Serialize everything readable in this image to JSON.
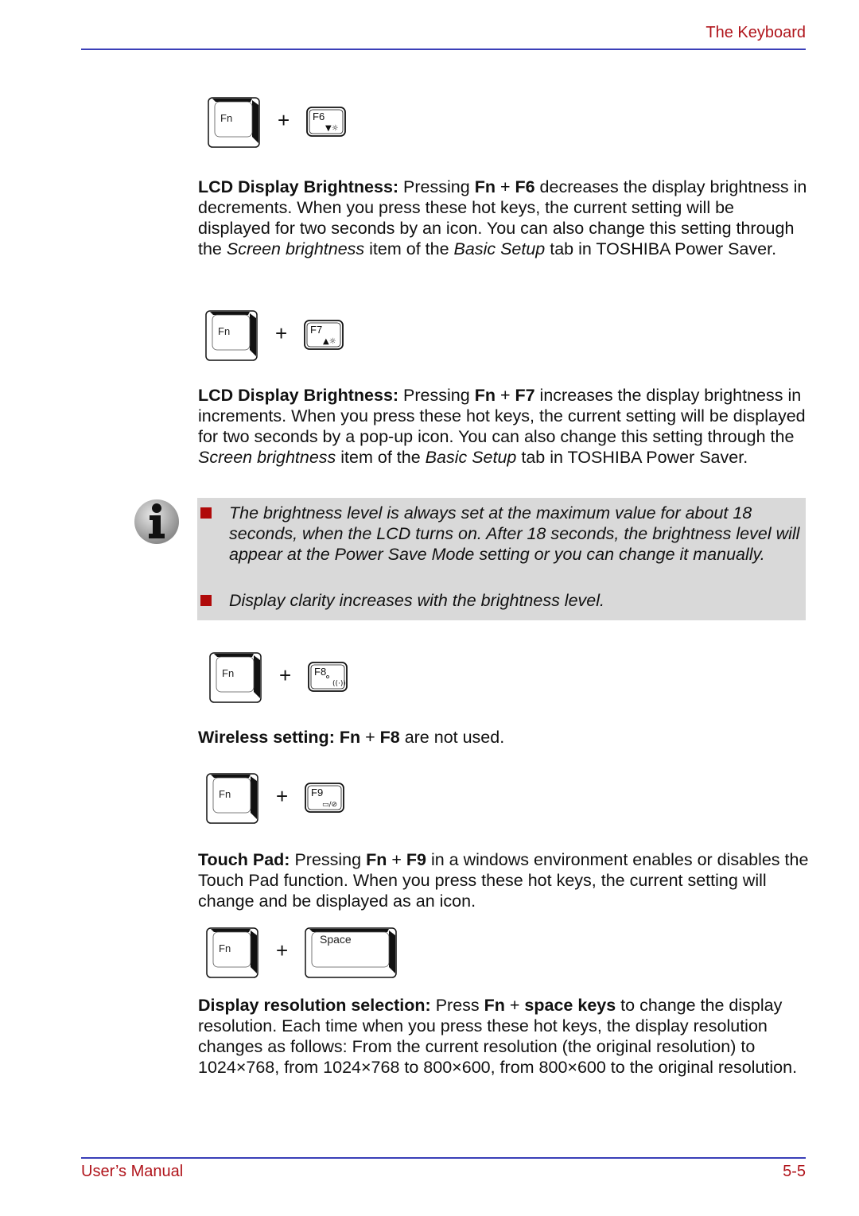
{
  "header": {
    "title": "The Keyboard"
  },
  "footer": {
    "left": "User’s Manual",
    "right": "5-5"
  },
  "keys": {
    "fn": "Fn",
    "plus": "+",
    "f6": "F6",
    "f7": "F7",
    "f8": "F8",
    "f9": "F9",
    "space": "Space"
  },
  "sections": {
    "f6": {
      "heading": "LCD Display Brightness:",
      "t1": " Pressing ",
      "k1": "Fn",
      "t2": " + ",
      "k2": "F6",
      "t3": " decreases the display brightness in decrements. When you press these hot keys, the current setting will be displayed for two seconds by an icon. You can also change this setting through the ",
      "i1": "Screen brightness",
      "t4": " item of the ",
      "i2": "Basic Setup",
      "t5": " tab in TOSHIBA Power Saver."
    },
    "f7": {
      "heading": "LCD Display Brightness:",
      "t1": " Pressing ",
      "k1": "Fn",
      "t2": " + ",
      "k2": "F7",
      "t3": " increases the display brightness in increments. When you press these hot keys, the current setting will be displayed for two seconds by a pop-up icon. You can also change this setting through the ",
      "i1": "Screen brightness",
      "t4": " item of the ",
      "i2": "Basic Setup",
      "t5": " tab in TOSHIBA Power Saver."
    },
    "note": {
      "items": [
        "The brightness level is always set at the maximum value for about 18 seconds, when the LCD turns on. After 18 seconds, the brightness level will appear at the Power Save Mode setting or you can change it manually.",
        "Display clarity increases with the brightness level."
      ]
    },
    "f8": {
      "heading": "Wireless setting:  ",
      "k1": "Fn",
      "t2": " + ",
      "k2": "F8",
      "t3": " are not used."
    },
    "f9": {
      "heading": "Touch Pad:",
      "t1": " Pressing ",
      "k1": "Fn",
      "t2": " + ",
      "k2": "F9",
      "t3": " in a windows environment enables or disables the Touch Pad function. When you press these hot keys, the current setting will change and be displayed as an icon."
    },
    "space": {
      "heading": "Display resolution selection:",
      "t1": " Press ",
      "k1": "Fn",
      "t2": " + ",
      "k2": "space keys",
      "t3": " to change the display resolution. Each time when you press these hot keys, the display resolution changes as follows: From the current resolution (the original resolution) to 1024×768, from 1024×768 to 800×600, from 800×600 to the original resolution."
    }
  },
  "colors": {
    "accent": "#b0141b",
    "rule": "#3a3fb8",
    "note_bg": "#d9d9d9",
    "bullet": "#b00a0a"
  }
}
